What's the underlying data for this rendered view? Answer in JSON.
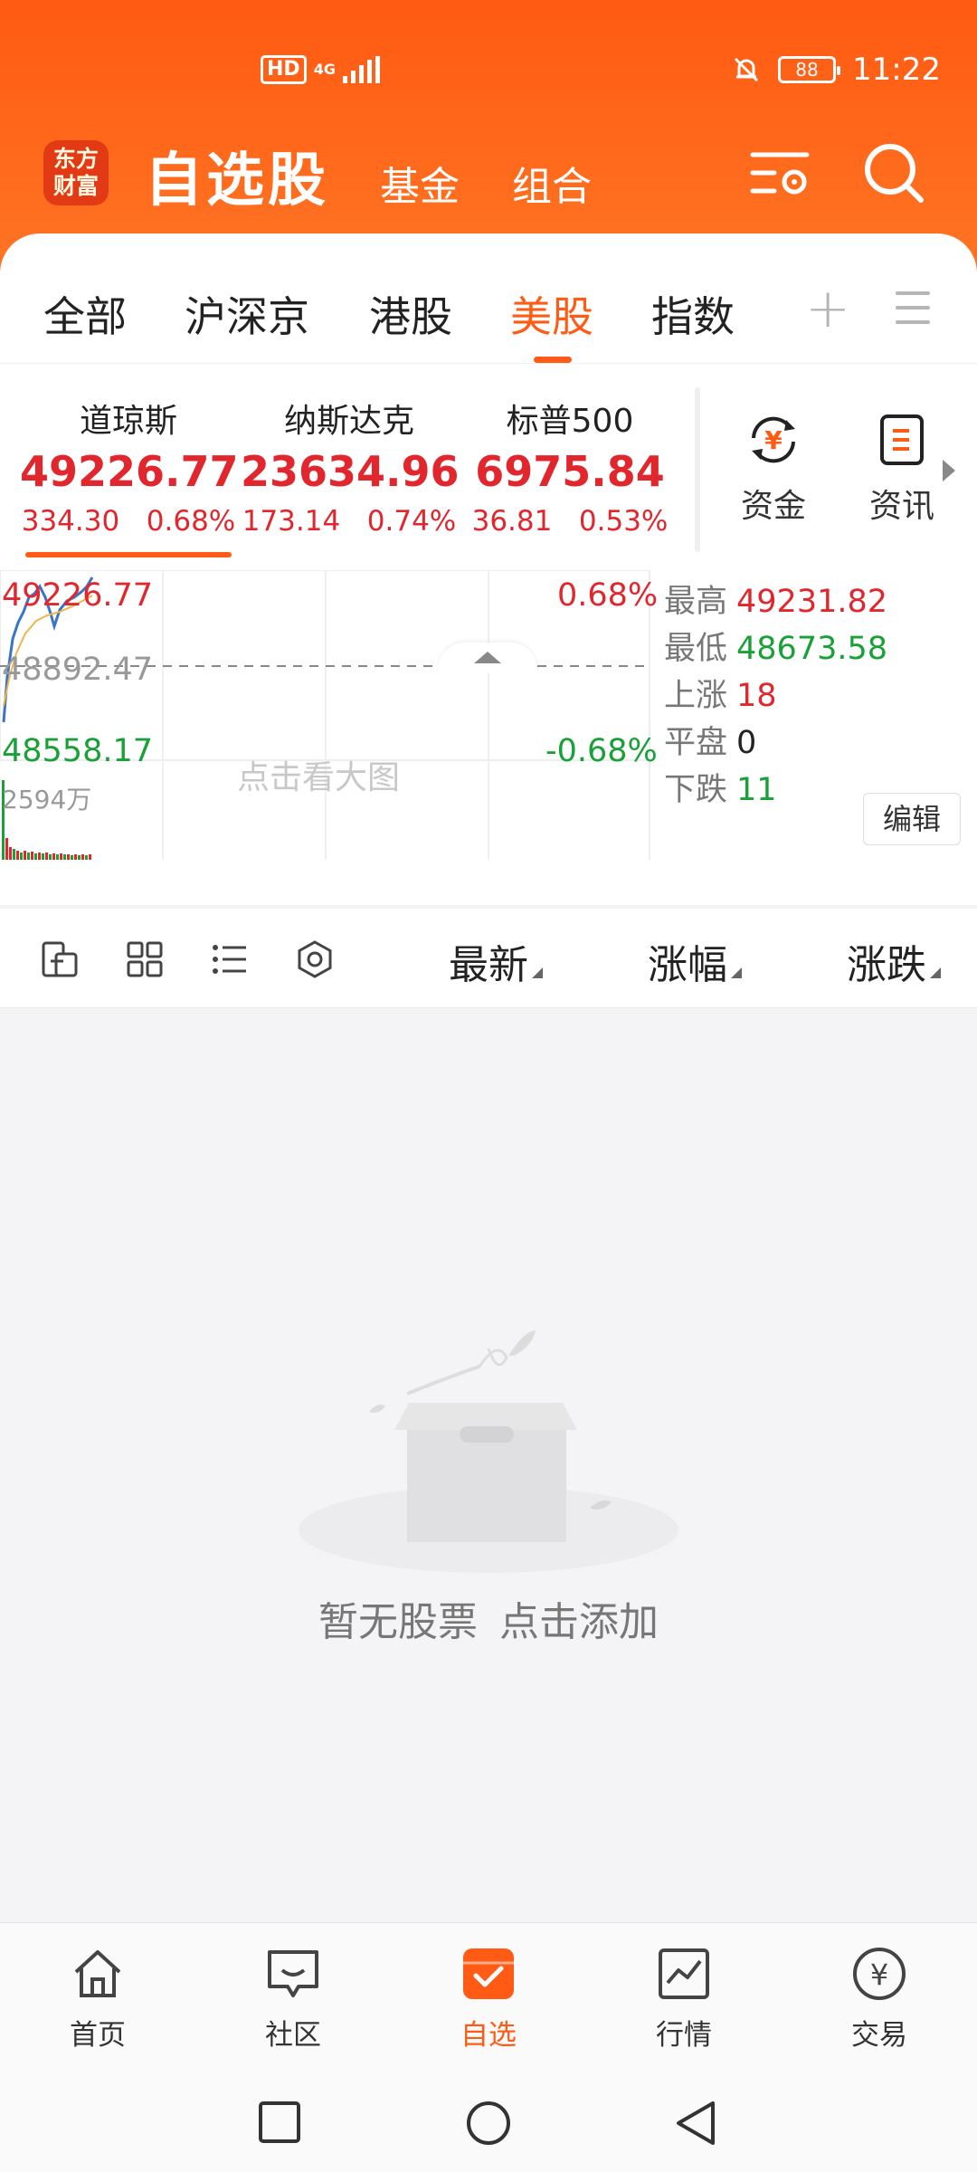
{
  "status_bar": {
    "hd": "HD",
    "network": "4G",
    "battery": "88",
    "time": "11:22"
  },
  "header": {
    "logo": "东方财富",
    "title": "自选股",
    "tabs": [
      "基金",
      "组合"
    ],
    "icons": [
      "list-settings-icon",
      "search-icon"
    ]
  },
  "market_tabs": {
    "items": [
      "全部",
      "沪深京",
      "港股",
      "美股",
      "指数"
    ],
    "active": "美股",
    "icons": [
      "add-icon",
      "menu-icon"
    ]
  },
  "indices": [
    {
      "name": "道琼斯",
      "value": "49226.77",
      "change": "334.30",
      "pct": "0.68%"
    },
    {
      "name": "纳斯达克",
      "value": "23634.96",
      "change": "173.14",
      "pct": "0.74%"
    },
    {
      "name": "标普500",
      "value": "6975.84",
      "change": "36.81",
      "pct": "0.53%"
    }
  ],
  "quick_buttons": [
    {
      "label": "资金",
      "icon": "yuan-cycle-icon"
    },
    {
      "label": "资讯",
      "icon": "news-doc-icon"
    }
  ],
  "mini_chart": {
    "high": "49226.77",
    "prev_close": "48892.47",
    "low": "48558.17",
    "high_pct": "0.68%",
    "low_pct": "-0.68%",
    "volume": "2594万",
    "tap_hint": "点击看大图",
    "stats": [
      {
        "label": "最高",
        "value": "49231.82",
        "color": "#e1272d"
      },
      {
        "label": "最低",
        "value": "48673.58",
        "color": "#19a138"
      },
      {
        "label": "上涨",
        "value": "18",
        "color": "#e1272d"
      },
      {
        "label": "平盘",
        "value": "0",
        "color": "#222222"
      },
      {
        "label": "下跌",
        "value": "11",
        "color": "#19a138"
      }
    ],
    "edit_label": "编辑"
  },
  "toolbar": {
    "icons": [
      "import-icon",
      "grid-icon",
      "list-icon",
      "settings-hex-icon"
    ],
    "columns": [
      "最新",
      "涨幅",
      "涨跌"
    ]
  },
  "empty_state": {
    "text1": "暂无股票",
    "text2": "点击添加"
  },
  "bottom_nav": [
    {
      "label": "首页",
      "icon": "home-icon"
    },
    {
      "label": "社区",
      "icon": "chat-icon"
    },
    {
      "label": "自选",
      "icon": "check-box-icon"
    },
    {
      "label": "行情",
      "icon": "trend-chart-icon"
    },
    {
      "label": "交易",
      "icon": "yuan-circle-icon"
    }
  ],
  "colors": {
    "accent": "#ff5b14",
    "up": "#e1272d",
    "down": "#19a138"
  }
}
